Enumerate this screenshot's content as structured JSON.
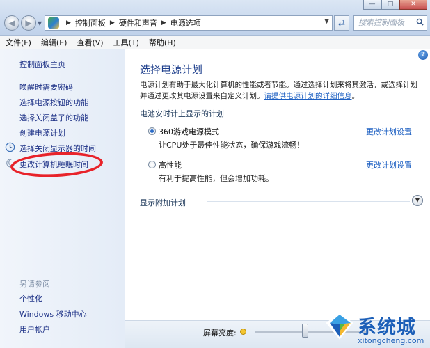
{
  "window": {
    "minimize_glyph": "—",
    "maximize_glyph": "□",
    "close_glyph": "✕"
  },
  "address": {
    "segments": [
      "控制面板",
      "硬件和声音",
      "电源选项"
    ],
    "search_placeholder": "搜索控制面板"
  },
  "menu": [
    "文件(F)",
    "编辑(E)",
    "查看(V)",
    "工具(T)",
    "帮助(H)"
  ],
  "sidebar": {
    "home": "控制面板主页",
    "links": [
      "唤醒时需要密码",
      "选择电源按钮的功能",
      "选择关闭盖子的功能",
      "创建电源计划",
      "选择关闭显示器的时间",
      "更改计算机睡眠时间"
    ],
    "see_also_label": "另请参阅",
    "see_also": [
      "个性化",
      "Windows 移动中心",
      "用户帐户"
    ]
  },
  "main": {
    "title": "选择电源计划",
    "description": "电源计划有助于最大化计算机的性能或者节能。通过选择计划来将其激活，或选择计划并通过更改其电源设置来自定义计划。",
    "description_link": "请提供电源计划的详细信息",
    "description_end": "。",
    "group_heading": "电池安时计上显示的计划",
    "plans": [
      {
        "name": "360游戏电源模式",
        "desc": "让CPU处于最佳性能状态，确保游戏流畅！",
        "selected": true,
        "link": "更改计划设置"
      },
      {
        "name": "高性能",
        "desc": "有利于提高性能，但会增加功耗。",
        "selected": false,
        "link": "更改计划设置"
      }
    ],
    "more_heading": "显示附加计划"
  },
  "bottom": {
    "brightness_label": "屏幕亮度:",
    "brightness_level": 0.45
  },
  "watermark": {
    "brand": "系统城",
    "url": "xitongcheng.com"
  },
  "colors": {
    "link": "#1e3287",
    "accent": "#1c5fc2",
    "annotation": "#e8232a"
  }
}
